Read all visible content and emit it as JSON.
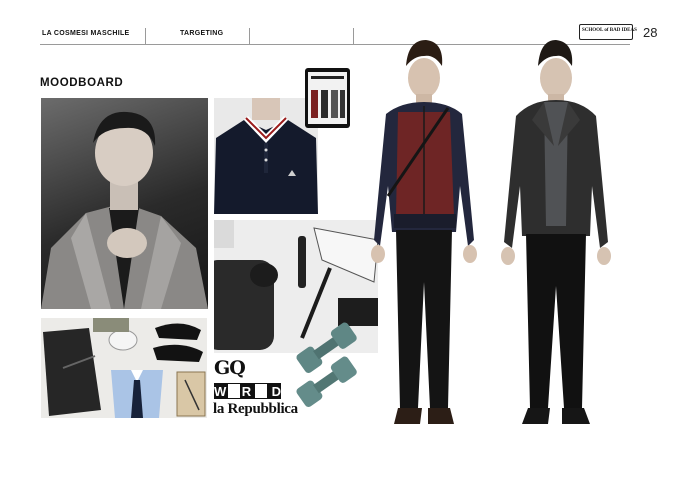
{
  "header": {
    "section": "LA COSMESI MASCHILE",
    "subsection": "TARGETING",
    "brand": "SCHOOL of BAD IDEAS",
    "page_number": "28"
  },
  "moodboard": {
    "title": "MOODBOARD"
  },
  "magazines": {
    "gq": "GQ",
    "wired": "WIRED",
    "repubblica": "la Repubblica"
  },
  "colors": {
    "burgundy": "#7a2a2a",
    "navy": "#1d2238",
    "charcoal": "#2c2c2c",
    "teal": "#5e8583"
  }
}
